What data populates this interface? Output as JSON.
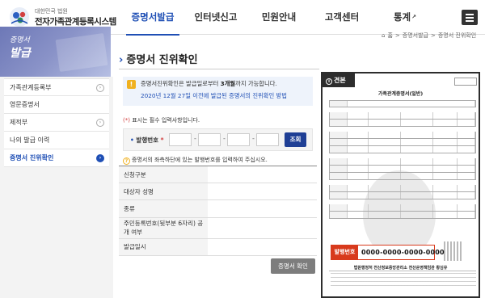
{
  "header": {
    "logo_top": "대한민국 법원",
    "logo_main": "전자가족관계등록시스템",
    "nav": [
      {
        "label": "증명서발급",
        "active": true
      },
      {
        "label": "인터넷신고",
        "active": false
      },
      {
        "label": "민원안내",
        "active": false
      },
      {
        "label": "고객센터",
        "active": false
      },
      {
        "label": "통계",
        "active": false
      }
    ],
    "external_icon": "↗"
  },
  "breadcrumb": {
    "home_icon": "⌂",
    "home": "홈",
    "sep": ">",
    "level1": "증명서발급",
    "current": "증명서 진위확인"
  },
  "sidebar": {
    "banner_line1": "증명서",
    "banner_line2": "발급",
    "items": [
      {
        "label": "가족관계등록부",
        "arrow": "›",
        "active": false
      },
      {
        "label": "영문증명서",
        "arrow": "",
        "active": false
      },
      {
        "label": "제적부",
        "arrow": "›",
        "active": false
      },
      {
        "label": "나의 발급 이력",
        "arrow": "",
        "active": false
      },
      {
        "label": "증명서 진위확인",
        "arrow": "›",
        "active": true
      }
    ]
  },
  "main": {
    "title": "증명서 진위확인",
    "title_bullet": "›",
    "notice_icon": "!",
    "notice_line1_a": "증명서진위확인은 발급일로부터 ",
    "notice_line1_b": "3개월",
    "notice_line1_c": "까지 가능합니다.",
    "notice_line2": "2020년 12월 27일 이전에 발급된 증명서의 진위확인 방법",
    "required_star": "(*)",
    "required_text": " 표시는 필수 입력사항입니다.",
    "form": {
      "dot": "•",
      "label": "발행번호",
      "star": "*",
      "segments": [
        "",
        "",
        "",
        ""
      ],
      "dash": "-",
      "search_button": "조회"
    },
    "hint_icon": "?",
    "hint": "증명서의 좌측하단에 있는 발행번호를 입력하여 주십시오.",
    "result_rows": [
      {
        "label": "신청구분",
        "value": ""
      },
      {
        "label": "대상자 성명",
        "value": ""
      },
      {
        "label": "종류",
        "value": ""
      },
      {
        "label": "주민등록번호(뒷부분 6자리) 공개 여부",
        "value": ""
      },
      {
        "label": "발급일시",
        "value": ""
      }
    ],
    "confirm_button": "증명서 확인"
  },
  "sample_doc": {
    "tag_icon": "i",
    "tag": "견본",
    "title": "가족관계증명서(일반)",
    "office": "법원행정처 전산정보중앙관리소 전산운영책임관 황심유",
    "issue_label": "발행번호",
    "issue_number": "0000-0000-0000-0000"
  }
}
